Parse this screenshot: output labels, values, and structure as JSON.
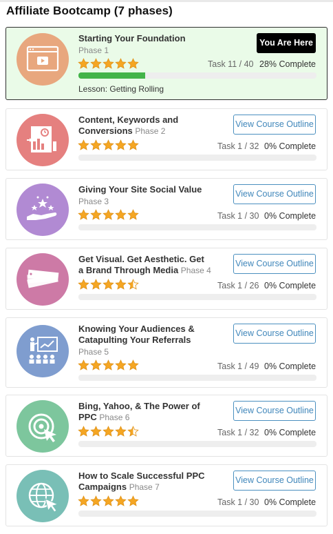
{
  "page": {
    "title": "Affiliate Bootcamp (7 phases)"
  },
  "colors": {
    "current_bg": "#eafbe8",
    "progress_fill": "#43b449",
    "star": "#f5a623",
    "link": "#3f86ba"
  },
  "current": {
    "title": "Starting Your Foundation",
    "phase": "Phase 1",
    "badge": "You Are Here",
    "task": "Task 11 / 40",
    "percent": "28% Complete",
    "progress": 0.28,
    "rating": 5,
    "lesson": "Lesson: Getting Rolling",
    "icon": "video-player-icon",
    "icon_color": "#e8a77e"
  },
  "phases": [
    {
      "title_line1": "Content, Keywords and",
      "title_line2": "Conversions",
      "phase": "Phase 2",
      "task": "Task 1 / 32",
      "percent": "0% Complete",
      "rating": 5,
      "button": "View Course Outline",
      "icon": "analytics-document-icon",
      "icon_color": "#e5807f"
    },
    {
      "title_line1": "Giving Your Site Social Value",
      "title_line2": "",
      "phase": "Phase 3",
      "task": "Task 1 / 30",
      "percent": "0% Complete",
      "rating": 5,
      "button": "View Course Outline",
      "icon": "hand-stars-icon",
      "icon_color": "#b18ad3"
    },
    {
      "title_line1": "Get Visual. Get Aesthetic. Get",
      "title_line2": "a Brand Through Media",
      "phase": "Phase 4",
      "task": "Task 1 / 26",
      "percent": "0% Complete",
      "rating": 4.5,
      "button": "View Course Outline",
      "icon": "color-swatches-icon",
      "icon_color": "#cd7aa6"
    },
    {
      "title_line1": "Knowing Your Audiences &",
      "title_line2": "Catapulting Your Referrals",
      "phase": "Phase 5",
      "task": "Task 1 / 49",
      "percent": "0% Complete",
      "rating": 5,
      "button": "View Course Outline",
      "icon": "presentation-audience-icon",
      "icon_color": "#7f9dcf"
    },
    {
      "title_line1": "Bing, Yahoo, & The Power of",
      "title_line2": "PPC",
      "phase": "Phase 6",
      "task": "Task 1 / 32",
      "percent": "0% Complete",
      "rating": 4.5,
      "button": "View Course Outline",
      "icon": "target-cursor-icon",
      "icon_color": "#7dc69d"
    },
    {
      "title_line1": "How to Scale Successful PPC",
      "title_line2": "Campaigns",
      "phase": "Phase 7",
      "task": "Task 1 / 30",
      "percent": "0% Complete",
      "rating": 5,
      "button": "View Course Outline",
      "icon": "globe-cursor-icon",
      "icon_color": "#79bfb6"
    }
  ]
}
